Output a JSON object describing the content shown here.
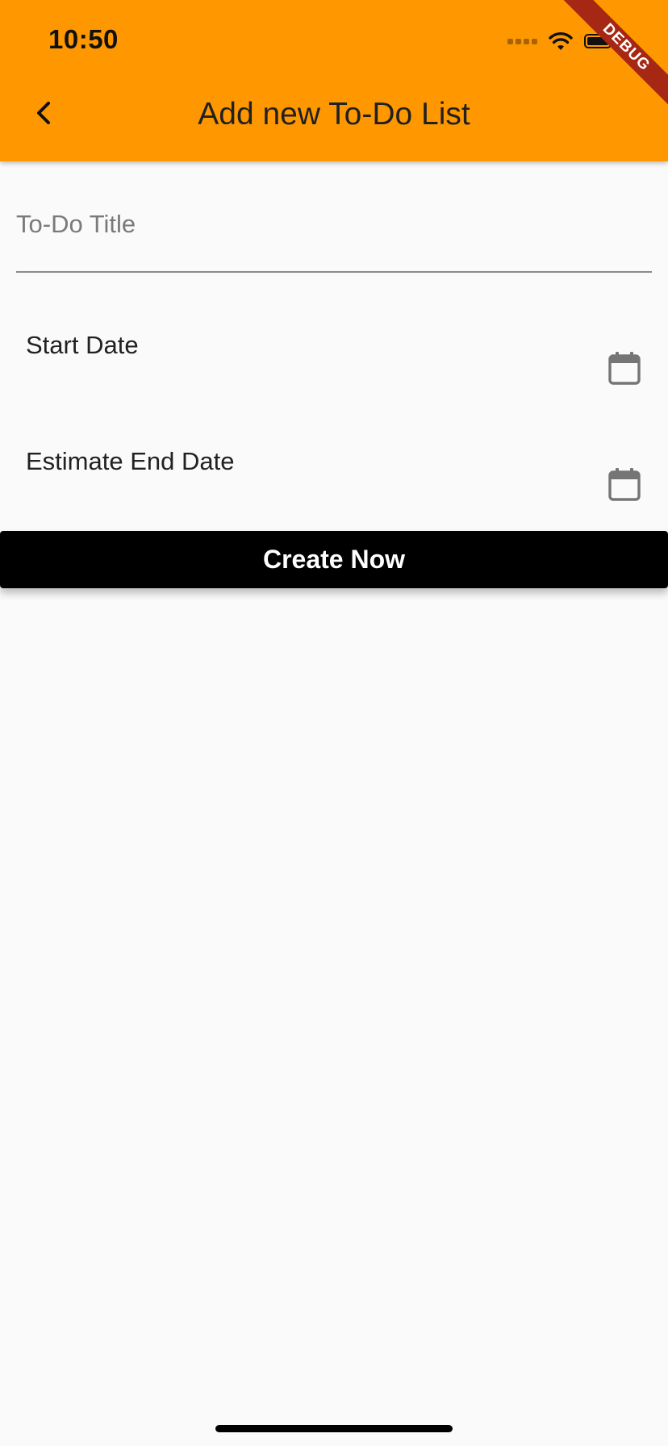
{
  "status_bar": {
    "time": "10:50",
    "icons": [
      "cellular-signal-icon",
      "wifi-icon",
      "battery-icon"
    ]
  },
  "debug_banner": "DEBUG",
  "app_bar": {
    "back_icon": "chevron-left-icon",
    "title": "Add new To-Do List",
    "background_color": "#ff9800"
  },
  "form": {
    "title_field": {
      "placeholder": "To-Do Title",
      "value": ""
    },
    "start_date": {
      "label": "Start Date",
      "icon": "calendar-icon"
    },
    "end_date": {
      "label": "Estimate End Date",
      "icon": "calendar-icon"
    },
    "submit_label": "Create Now"
  },
  "colors": {
    "accent": "#ff9800",
    "button": "#000000",
    "debug_banner": "#a52714",
    "background": "#fafafa"
  }
}
